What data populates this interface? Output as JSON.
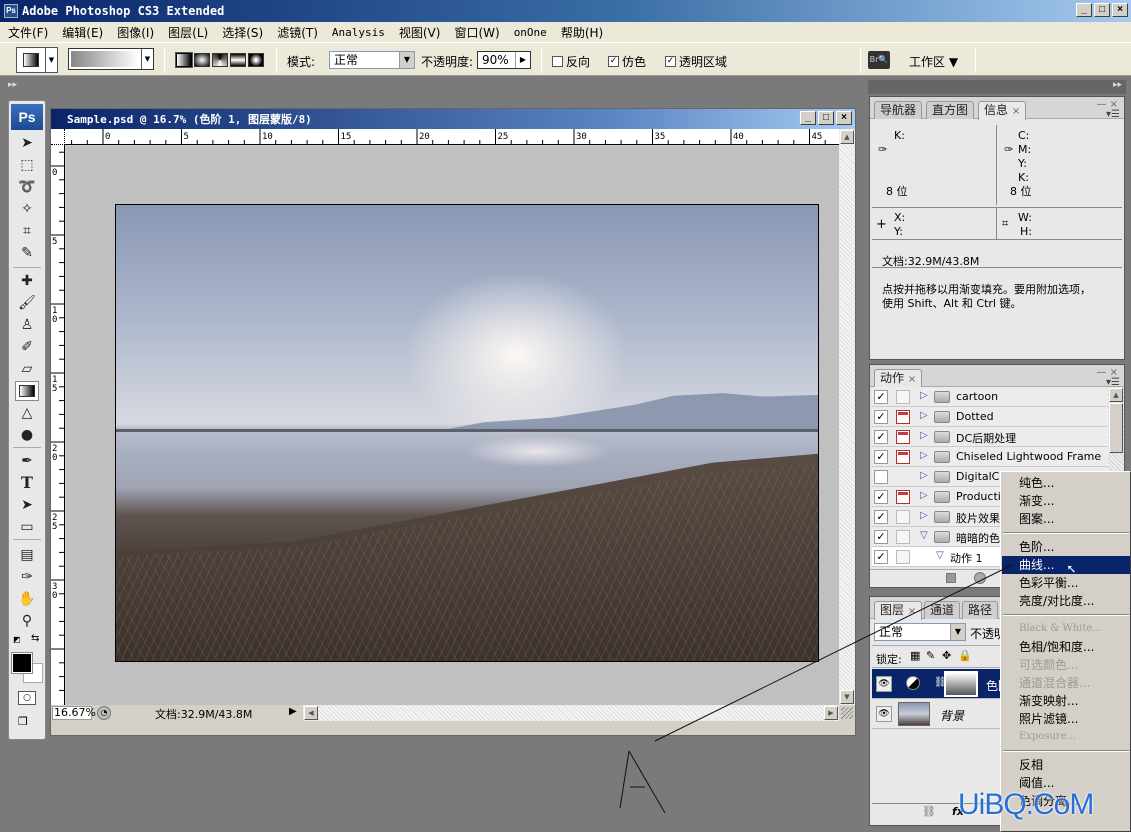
{
  "app": {
    "title": "Adobe Photoshop CS3 Extended",
    "logo": "Ps"
  },
  "menu": [
    "文件(F)",
    "编辑(E)",
    "图像(I)",
    "图层(L)",
    "选择(S)",
    "滤镜(T)",
    "Analysis",
    "视图(V)",
    "窗口(W)",
    "onOne",
    "帮助(H)"
  ],
  "options": {
    "mode_label": "模式:",
    "mode_value": "正常",
    "opacity_label": "不透明度:",
    "opacity_value": "90%",
    "reverse_label": "反向",
    "reverse_checked": false,
    "dither_label": "仿色",
    "dither_checked": true,
    "transparency_label": "透明区域",
    "transparency_checked": true,
    "workspace_label": "工作区 ▼",
    "gradient_types": [
      "linear",
      "radial",
      "angle",
      "reflected",
      "diamond"
    ]
  },
  "toolbox": {
    "tools": [
      {
        "name": "move",
        "glyph": "➤"
      },
      {
        "name": "marquee",
        "glyph": "⬚"
      },
      {
        "name": "lasso",
        "glyph": "➰"
      },
      {
        "name": "magic-wand",
        "glyph": "✧"
      },
      {
        "name": "crop",
        "glyph": "⌗"
      },
      {
        "name": "slice",
        "glyph": "✎"
      },
      {
        "name": "healing-brush",
        "glyph": "✚"
      },
      {
        "name": "brush",
        "glyph": "🖌"
      },
      {
        "name": "clone-stamp",
        "glyph": "♙"
      },
      {
        "name": "history-brush",
        "glyph": "✐"
      },
      {
        "name": "eraser",
        "glyph": "▱"
      },
      {
        "name": "gradient",
        "glyph": "▦"
      },
      {
        "name": "blur",
        "glyph": "△"
      },
      {
        "name": "dodge",
        "glyph": "●"
      },
      {
        "name": "pen",
        "glyph": "✒"
      },
      {
        "name": "type",
        "glyph": "T"
      },
      {
        "name": "path-selection",
        "glyph": "➤"
      },
      {
        "name": "shape",
        "glyph": "▭"
      },
      {
        "name": "notes",
        "glyph": "▤"
      },
      {
        "name": "eyedropper",
        "glyph": "✑"
      },
      {
        "name": "hand",
        "glyph": "✋"
      },
      {
        "name": "zoom",
        "glyph": "⚲"
      }
    ],
    "foreground_color": "#000000",
    "background_color": "#ffffff"
  },
  "document": {
    "title": "Sample.psd @ 16.7% (色阶 1, 图层蒙版/8)",
    "ruler_top": [
      "0",
      "5",
      "10",
      "15",
      "20",
      "25",
      "30",
      "35",
      "40",
      "45"
    ],
    "ruler_left": [
      "0",
      "5",
      "10",
      "15",
      "20",
      "25",
      "30"
    ],
    "zoom": "16.67%",
    "doc_size": "文档:32.9M/43.8M"
  },
  "info_panel": {
    "tabs": [
      "导航器",
      "直方图",
      "信息"
    ],
    "active_tab": "信息",
    "left_k": "K:",
    "right_c": "C:",
    "right_m": "M:",
    "right_y": "Y:",
    "right_k": "K:",
    "left_bits": "8 位",
    "right_bits": "8 位",
    "x": "X:",
    "y": "Y:",
    "w": "W:",
    "h": "H:",
    "doc_size": "文档:32.9M/43.8M",
    "hint_line1": "点按并拖移以用渐变填充。要用附加选项，",
    "hint_line2": "使用 Shift、Alt 和 Ctrl 键。"
  },
  "actions_panel": {
    "tab": "动作",
    "items": [
      {
        "name": "cartoon",
        "checked": true,
        "dialog": false,
        "expanded": false
      },
      {
        "name": "Dotted",
        "checked": true,
        "dialog": true,
        "expanded": false
      },
      {
        "name": "DC后期处理",
        "checked": true,
        "dialog": true,
        "expanded": false
      },
      {
        "name": "Chiseled Lightwood Frame",
        "checked": true,
        "dialog": true,
        "expanded": false
      },
      {
        "name": "DigitalCa",
        "checked": false,
        "dialog": false,
        "expanded": false
      },
      {
        "name": "Productio",
        "checked": true,
        "dialog": true,
        "expanded": false
      },
      {
        "name": "胶片效果",
        "checked": true,
        "dialog": false,
        "expanded": false
      },
      {
        "name": "暗暗的色",
        "checked": true,
        "dialog": false,
        "expanded": true
      },
      {
        "name": "动作 1",
        "checked": true,
        "dialog": false,
        "expanded": true,
        "child": true
      }
    ]
  },
  "layers_panel": {
    "tabs": [
      "图层",
      "通道",
      "路径"
    ],
    "blend_mode": "正常",
    "opacity_label": "不透明",
    "lock_label": "锁定:",
    "layers": [
      {
        "name": "色阶 1",
        "visible": true,
        "selected": true,
        "type": "adjustment"
      },
      {
        "name": "背景",
        "visible": true,
        "selected": false,
        "type": "image"
      }
    ]
  },
  "context_menu": {
    "items": [
      {
        "label": "纯色...",
        "enabled": true
      },
      {
        "label": "渐变...",
        "enabled": true
      },
      {
        "label": "图案...",
        "enabled": true
      },
      {
        "sep": true
      },
      {
        "label": "色阶...",
        "enabled": true
      },
      {
        "label": "曲线...",
        "enabled": true,
        "highlighted": true
      },
      {
        "label": "色彩平衡...",
        "enabled": true
      },
      {
        "label": "亮度/对比度...",
        "enabled": true
      },
      {
        "sep": true
      },
      {
        "label": "Black & White...",
        "enabled": false,
        "latin": true
      },
      {
        "label": "色相/饱和度...",
        "enabled": true
      },
      {
        "label": "可选颜色...",
        "enabled": false
      },
      {
        "label": "通道混合器...",
        "enabled": false
      },
      {
        "label": "渐变映射...",
        "enabled": true
      },
      {
        "label": "照片滤镜...",
        "enabled": true
      },
      {
        "label": "Exposure...",
        "enabled": false,
        "latin": true
      },
      {
        "sep": true
      },
      {
        "label": "反相",
        "enabled": true
      },
      {
        "label": "阈值...",
        "enabled": true
      },
      {
        "label": "色调分离...",
        "enabled": true
      }
    ]
  },
  "annotation": {
    "label": "A"
  },
  "watermark": "UiBQ.CoM"
}
